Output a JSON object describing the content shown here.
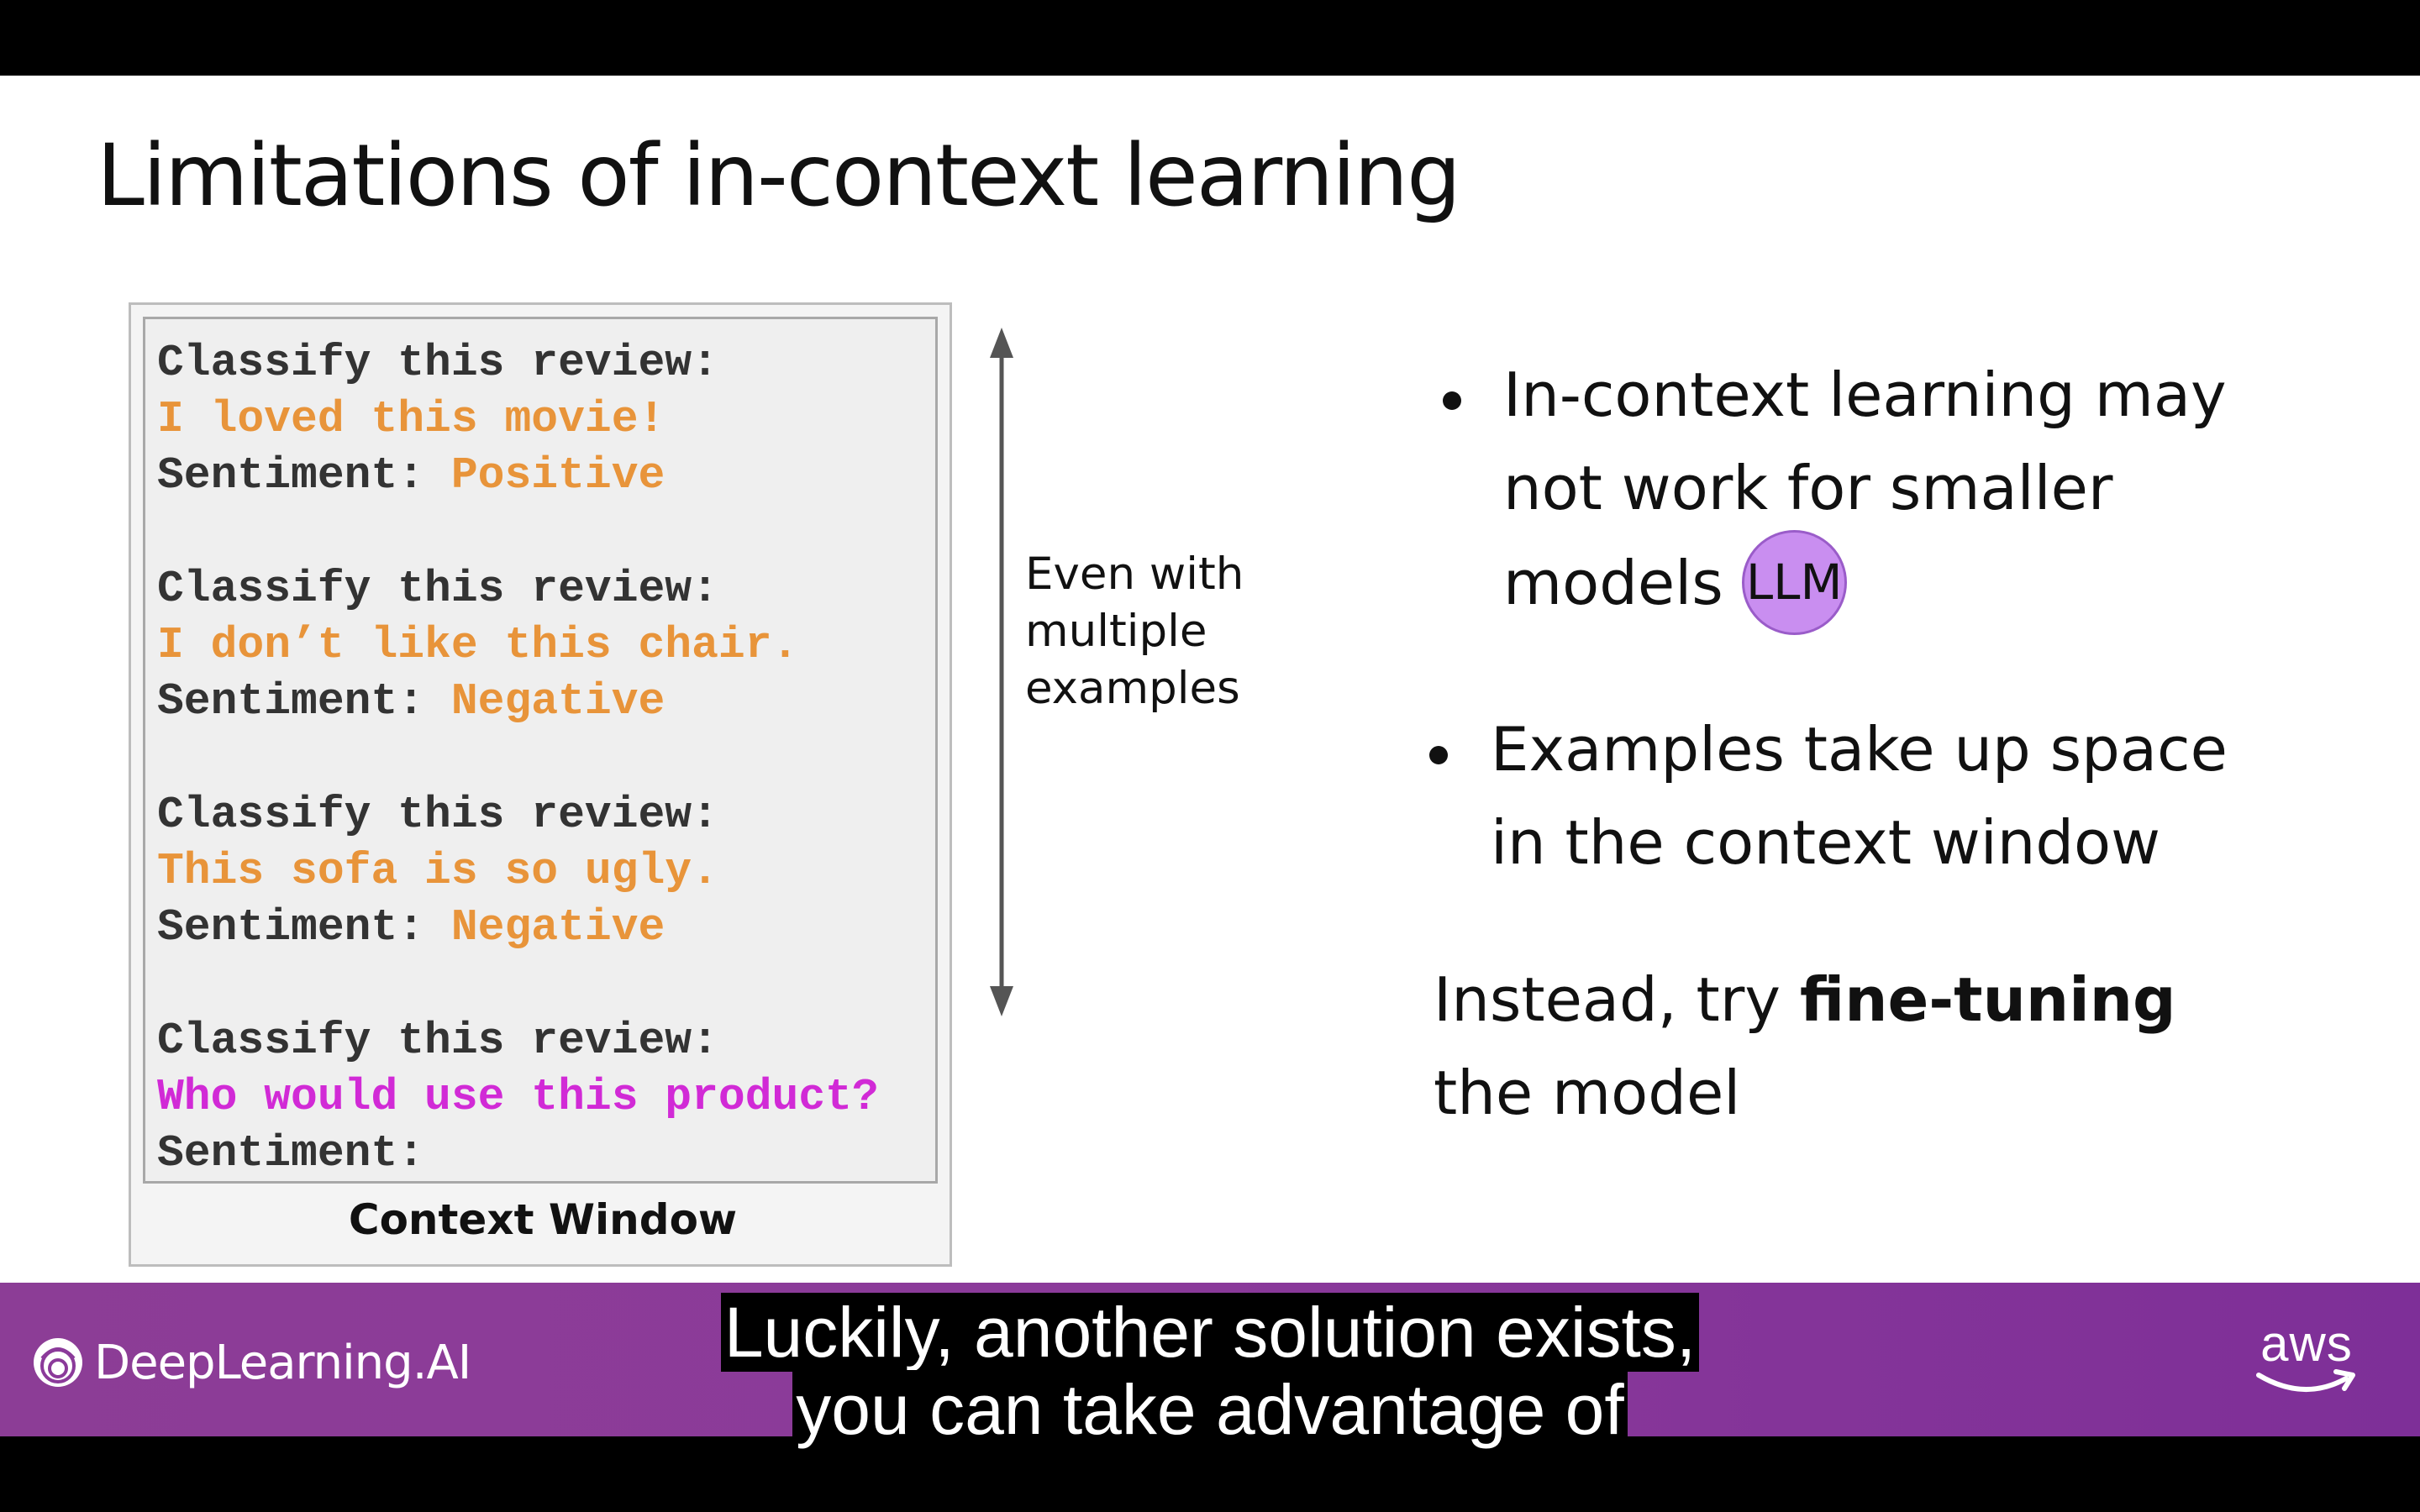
{
  "slide": {
    "title": "Limitations of in-context learning"
  },
  "context_window": {
    "label": "Context Window",
    "examples": [
      {
        "instruction": "Classify this review:",
        "review": "I loved this movie!",
        "sentiment_label": "Sentiment:",
        "sentiment_value": "Positive"
      },
      {
        "instruction": "Classify this review:",
        "review": "I don’t like this chair.",
        "sentiment_label": "Sentiment:",
        "sentiment_value": "Negative"
      },
      {
        "instruction": "Classify this review:",
        "review": "This sofa is so ugly.",
        "sentiment_label": "Sentiment:",
        "sentiment_value": "Negative"
      },
      {
        "instruction": "Classify this review:",
        "review": "Who would use this product?",
        "sentiment_label": "Sentiment:",
        "sentiment_value": ""
      }
    ],
    "colors": {
      "example_text": "#e8943a",
      "query_text": "#d12ad6",
      "plain_text": "#333333"
    }
  },
  "arrow_annotation": {
    "lines": [
      "Even with",
      "multiple",
      "examples"
    ]
  },
  "bullets": [
    {
      "lines": [
        "In-context learning may",
        "not work for smaller",
        "models"
      ],
      "badge": "LLM"
    },
    {
      "lines": [
        "Examples take up space",
        "in the context window"
      ]
    }
  ],
  "conclusion": {
    "prefix": "Instead, try ",
    "emphasis": "fine-tuning",
    "suffix": "the model"
  },
  "footer": {
    "brand_left": "DeepLearning.AI",
    "brand_right": "aws",
    "band_color": "#8b3a9a"
  },
  "captions": [
    "Luckily, another solution exists,",
    "you can take advantage of"
  ]
}
